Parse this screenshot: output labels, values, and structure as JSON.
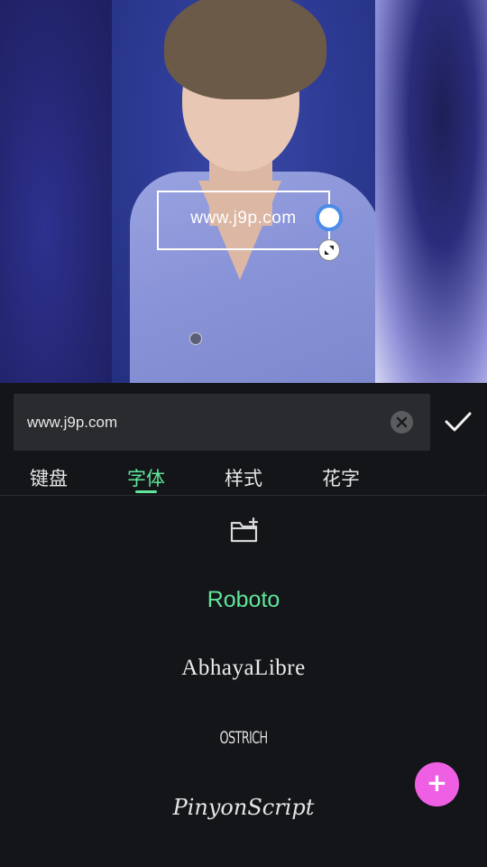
{
  "preview": {
    "overlay_text": "www.j9p.com"
  },
  "editor": {
    "input_value": "www.j9p.com",
    "clear_icon": "clear-icon",
    "confirm_icon": "checkmark-icon"
  },
  "tabs": [
    {
      "label": "键盘",
      "active": false
    },
    {
      "label": "字体",
      "active": true
    },
    {
      "label": "样式",
      "active": false
    },
    {
      "label": "花字",
      "active": false
    }
  ],
  "fonts": {
    "import_icon": "folder-add-icon",
    "items": [
      {
        "label": "Roboto",
        "selected": true
      },
      {
        "label": "AbhayaLibre",
        "selected": false
      },
      {
        "label": "OSTRICH",
        "selected": false
      },
      {
        "label": "PinyonScript",
        "selected": false
      }
    ]
  },
  "fab": {
    "label": "+"
  },
  "colors": {
    "accent_green": "#5fe69a",
    "fab_pink": "#ee5fe4",
    "handle_blue": "#4a8de8",
    "panel_bg": "#141518"
  }
}
